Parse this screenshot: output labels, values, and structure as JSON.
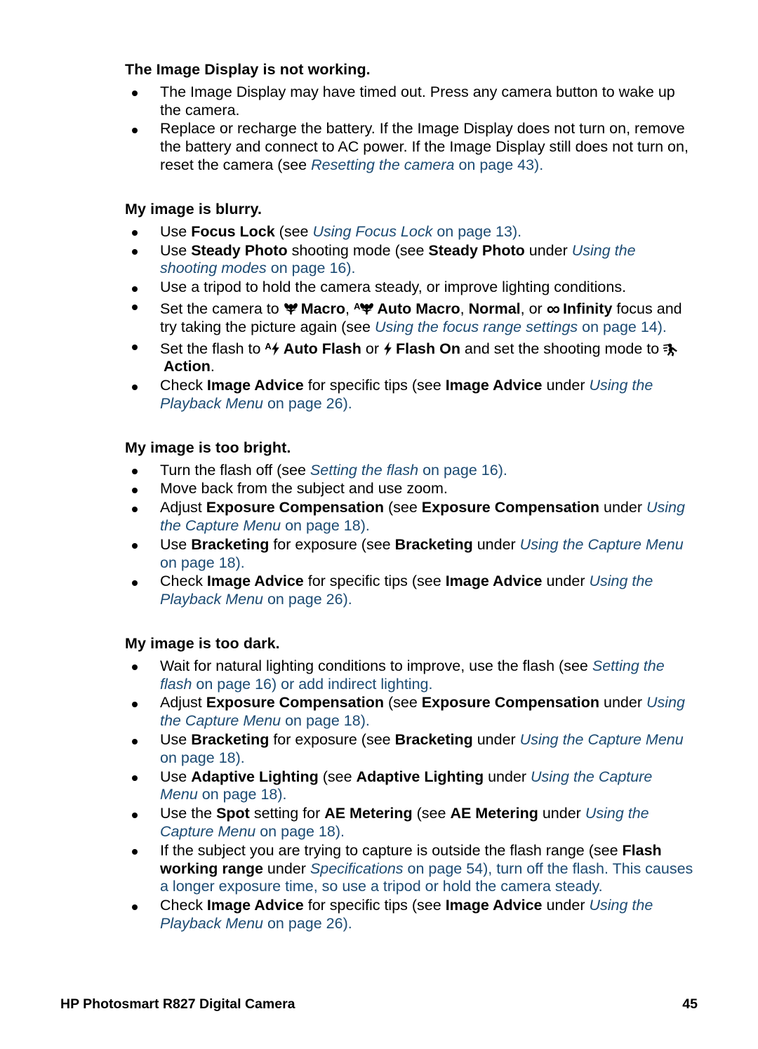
{
  "document": {
    "footer_title": "HP Photosmart R827 Digital Camera",
    "page_number": "45",
    "link_color": "#1b4a72"
  },
  "icons": {
    "macro": "flower-macro-icon",
    "auto_macro": "auto-flower-macro-icon",
    "infinity": "infinity-icon",
    "auto_flash": "auto-flash-icon",
    "flash_on": "flash-on-icon",
    "action": "action-running-icon"
  },
  "sections": [
    {
      "heading": "The Image Display is not working.",
      "bullets": [
        {
          "id": "display-timeout",
          "text": "The Image Display may have timed out. Press any camera button to wake up the camera."
        },
        {
          "id": "replace-battery",
          "text": "Replace or recharge the battery. If the Image Display does not turn on, remove the battery and connect to AC power. If the Image Display still does not turn on, reset the camera (see Resetting the camera on page 43).",
          "parts": {
            "lead": "Replace or recharge the battery. If the Image Display does not turn on, remove the battery and connect to AC power. If the Image Display still does not turn on, reset the camera (see ",
            "link": "Resetting the camera",
            "tail": " on page 43)."
          }
        }
      ]
    },
    {
      "heading": "My image is blurry.",
      "bullets": [
        {
          "id": "focus-lock",
          "parts": {
            "a": "Use ",
            "b_bold": "Focus Lock",
            "c": " (see ",
            "link": "Using Focus Lock",
            "tail": " on page 13)."
          }
        },
        {
          "id": "steady-photo",
          "parts": {
            "a": "Use ",
            "b_bold": "Steady Photo",
            "c": " shooting mode (see ",
            "d_bold": "Steady Photo",
            "e": " under ",
            "link": "Using the shooting modes",
            "tail": " on page 16)."
          }
        },
        {
          "id": "tripod",
          "text": "Use a tripod to hold the camera steady, or improve lighting conditions."
        },
        {
          "id": "focus-range",
          "parts": {
            "a": "Set the camera to ",
            "macro_label": "Macro",
            "sep1": ", ",
            "auto_macro_label": "Auto Macro",
            "sep2": ", ",
            "normal_label": "Normal",
            "sep3": ", or ",
            "infinity_label": "Infinity",
            "c": " focus and try taking the picture again (see ",
            "link": "Using the focus range settings",
            "tail": " on page 14)."
          }
        },
        {
          "id": "flash-action",
          "parts": {
            "a": "Set the flash to ",
            "auto_flash_label": "Auto Flash",
            "b": " or ",
            "flash_on_label": "Flash On",
            "c": " and set the shooting mode to ",
            "action_label": "Action",
            "tail": "."
          }
        },
        {
          "id": "image-advice-blurry",
          "parts": {
            "a": "Check ",
            "b_bold": "Image Advice",
            "c": " for specific tips (see ",
            "d_bold": "Image Advice",
            "e": " under ",
            "link": "Using the Playback Menu",
            "tail": " on page 26)."
          }
        }
      ]
    },
    {
      "heading": "My image is too bright.",
      "bullets": [
        {
          "id": "flash-off",
          "parts": {
            "a": "Turn the flash off (see ",
            "link": "Setting the flash",
            "tail": " on page 16)."
          }
        },
        {
          "id": "move-back",
          "text": "Move back from the subject and use zoom."
        },
        {
          "id": "exposure-comp-bright",
          "parts": {
            "a": "Adjust ",
            "b_bold": "Exposure Compensation",
            "c": " (see ",
            "d_bold": "Exposure Compensation",
            "e": " under ",
            "link": "Using the Capture Menu",
            "tail": " on page 18)."
          }
        },
        {
          "id": "bracketing-bright",
          "parts": {
            "a": "Use ",
            "b_bold": "Bracketing",
            "c": " for exposure (see ",
            "d_bold": "Bracketing",
            "e": " under ",
            "link": "Using the Capture Menu",
            "tail": " on page 18)."
          }
        },
        {
          "id": "image-advice-bright",
          "parts": {
            "a": "Check ",
            "b_bold": "Image Advice",
            "c": " for specific tips (see ",
            "d_bold": "Image Advice",
            "e": " under ",
            "link": "Using the Playback Menu",
            "tail": " on page 26)."
          }
        }
      ]
    },
    {
      "heading": "My image is too dark.",
      "bullets": [
        {
          "id": "natural-lighting",
          "parts": {
            "a": "Wait for natural lighting conditions to improve, use the flash (see ",
            "link": "Setting the flash",
            "tail": " on page 16) or add indirect lighting."
          }
        },
        {
          "id": "exposure-comp-dark",
          "parts": {
            "a": "Adjust ",
            "b_bold": "Exposure Compensation",
            "c": " (see ",
            "d_bold": "Exposure Compensation",
            "e": " under ",
            "link": "Using the Capture Menu",
            "tail": " on page 18)."
          }
        },
        {
          "id": "bracketing-dark",
          "parts": {
            "a": "Use ",
            "b_bold": "Bracketing",
            "c": " for exposure (see ",
            "d_bold": "Bracketing",
            "e": " under ",
            "link": "Using the Capture Menu",
            "tail": " on page 18)."
          }
        },
        {
          "id": "adaptive-lighting",
          "parts": {
            "a": "Use ",
            "b_bold": "Adaptive Lighting",
            "c": " (see ",
            "d_bold": "Adaptive Lighting",
            "e": " under ",
            "link": "Using the Capture Menu",
            "tail": " on page 18)."
          }
        },
        {
          "id": "spot-ae-metering",
          "parts": {
            "a": "Use the ",
            "b_bold": "Spot",
            "c": " setting for ",
            "c_bold": "AE Metering",
            "d": " (see ",
            "d_bold": "AE Metering",
            "e": " under ",
            "link": "Using the Capture Menu",
            "tail": " on page 18)."
          }
        },
        {
          "id": "flash-range",
          "parts": {
            "a": "If the subject you are trying to capture is outside the flash range (see ",
            "b_bold": "Flash working range",
            "c": " under ",
            "link": "Specifications",
            "tail": " on page 54), turn off the flash. This causes a longer exposure time, so use a tripod or hold the camera steady."
          }
        },
        {
          "id": "image-advice-dark",
          "parts": {
            "a": "Check ",
            "b_bold": "Image Advice",
            "c": " for specific tips (see ",
            "d_bold": "Image Advice",
            "e": " under ",
            "link": "Using the Playback Menu",
            "tail": " on page 26)."
          }
        }
      ]
    }
  ]
}
